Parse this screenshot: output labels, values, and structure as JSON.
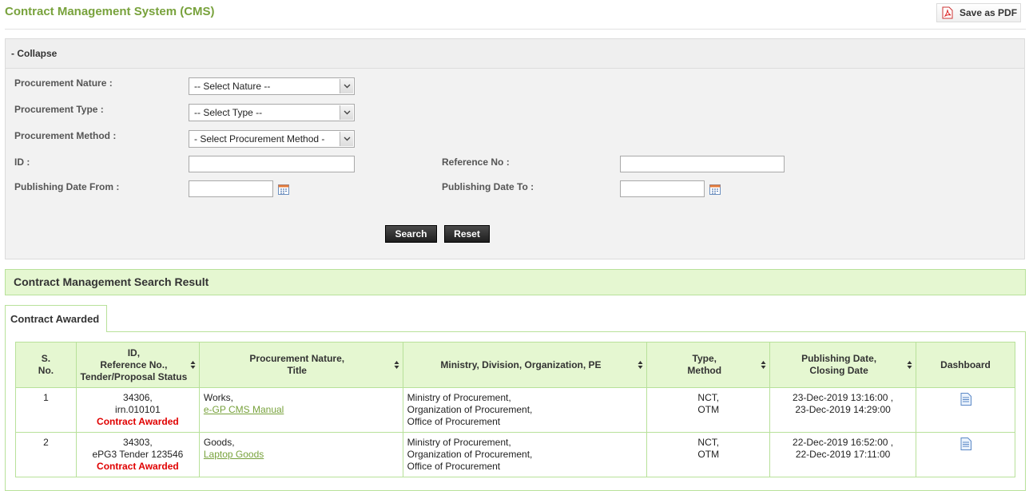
{
  "header": {
    "title": "Contract Management System (CMS)",
    "save_pdf_label": "Save as PDF",
    "save_pdf_icon": "pdf-icon"
  },
  "search": {
    "collapse_label": "- Collapse",
    "nature_label": "Procurement Nature :",
    "nature_value": "-- Select Nature --",
    "type_label": "Procurement Type :",
    "type_value": "-- Select Type --",
    "method_label": "Procurement Method :",
    "method_value": "- Select Procurement Method -",
    "id_label": "ID :",
    "id_value": "",
    "ref_label": "Reference No :",
    "ref_value": "",
    "date_from_label": "Publishing Date From :",
    "date_from_value": "",
    "date_to_label": "Publishing Date To :",
    "date_to_value": "",
    "search_button": "Search",
    "reset_button": "Reset"
  },
  "results": {
    "section_title": "Contract Management Search Result",
    "tab_label": "Contract Awarded",
    "columns": [
      "S. No.",
      "ID, Reference No., Tender/Proposal Status",
      "Procurement Nature, Title",
      "Ministry, Division, Organization, PE",
      "Type, Method",
      "Publishing Date, Closing Date",
      "Dashboard"
    ],
    "column_lines": [
      [
        "S.",
        "No."
      ],
      [
        "ID,",
        "Reference No.,",
        "Tender/Proposal Status"
      ],
      [
        "Procurement Nature,",
        "Title"
      ],
      [
        "Ministry, Division, Organization, PE"
      ],
      [
        "Type,",
        "Method"
      ],
      [
        "Publishing Date,",
        "Closing Date"
      ],
      [
        "Dashboard"
      ]
    ],
    "rows": [
      {
        "sno": "1",
        "id": "34306,",
        "ref": "irn.010101",
        "status": "Contract Awarded",
        "nature": "Works,",
        "title": "e-GP CMS Manual",
        "ministry": "Ministry of Procurement,",
        "org": "Organization of Procurement,",
        "pe": "Office of Procurement",
        "type": "NCT,",
        "method": "OTM",
        "pub_date": "23-Dec-2019 13:16:00 ,",
        "close_date": "23-Dec-2019 14:29:00",
        "dashboard_icon": "document-icon"
      },
      {
        "sno": "2",
        "id": "34303,",
        "ref": "ePG3 Tender 123546",
        "status": "Contract Awarded",
        "nature": "Goods,",
        "title": "Laptop Goods",
        "ministry": "Ministry of Procurement,",
        "org": "Organization of Procurement,",
        "pe": "Office of Procurement",
        "type": "NCT,",
        "method": "OTM",
        "pub_date": "22-Dec-2019 16:52:00 ,",
        "close_date": "22-Dec-2019 17:11:00",
        "dashboard_icon": "document-icon"
      }
    ]
  },
  "colors": {
    "title_green": "#78a23c",
    "header_bg": "#e5f7d1",
    "border_green": "#b8e19a",
    "status_red": "#e00000"
  }
}
